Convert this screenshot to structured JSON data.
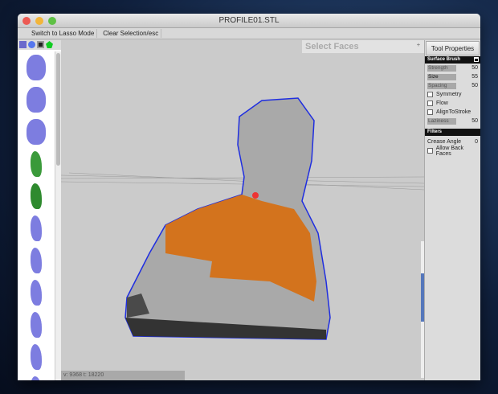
{
  "window": {
    "title": "PROFILE01.STL",
    "lights": [
      "#ec5a53",
      "#f2b53a",
      "#5fc145"
    ]
  },
  "toolbar": {
    "lasso": "Switch to Lasso Mode",
    "clear": "Clear Selection/esc"
  },
  "viewport": {
    "mode": "Select Faces",
    "mode_arrow": "+",
    "status": "v: 9368  t: 18220",
    "colors": {
      "mesh": "#a9a9a9",
      "selection": "#d3731d",
      "outline": "#1f2ee0"
    }
  },
  "panel": {
    "title": "Tool Properties",
    "surface_brush": "Surface Brush",
    "params": [
      {
        "label": "Strength",
        "value": "50"
      },
      {
        "label": "Size",
        "value": "55"
      },
      {
        "label": "Spacing",
        "value": "50"
      }
    ],
    "checks": [
      {
        "label": "Symmetry"
      },
      {
        "label": "Flow"
      },
      {
        "label": "AlignToStroke"
      }
    ],
    "laziness": {
      "label": "Laziness",
      "value": "50"
    },
    "filters": "Filters",
    "crease": {
      "label": "Crease Angle",
      "value": "0"
    },
    "backfaces": "Allow Back Faces"
  }
}
